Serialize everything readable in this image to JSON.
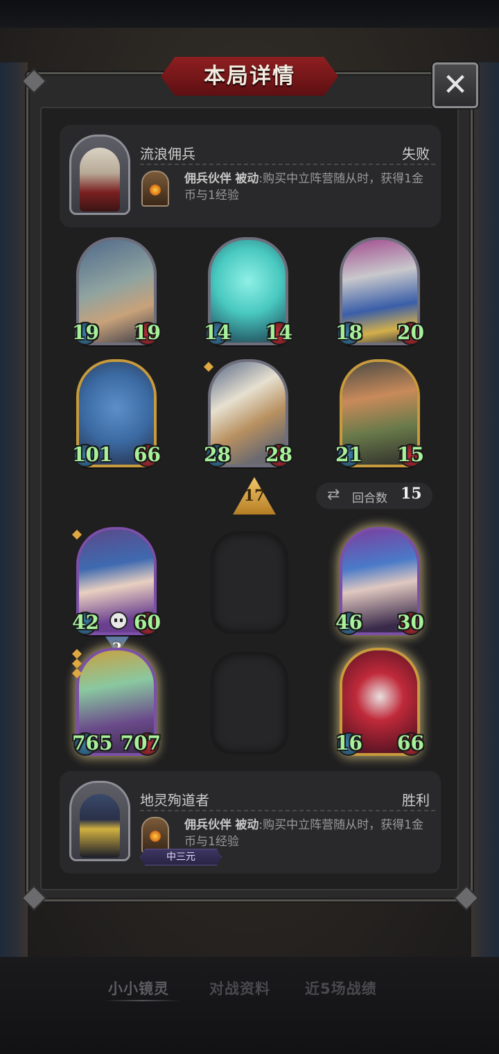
{
  "window": {
    "title": "本局详情",
    "close_icon": "close-icon"
  },
  "players": {
    "top": {
      "name": "流浪佣兵",
      "result": "失败",
      "hero_power_name": "佣兵伙伴",
      "hero_power_type": "被动",
      "hero_power_desc": ":购买中立阵营随从时，获得1金币与1经验"
    },
    "bottom": {
      "name": "地灵殉道者",
      "result": "胜利",
      "hero_power_name": "佣兵伙伴",
      "hero_power_type": "被动",
      "hero_power_desc": ":购买中立阵营随从时，获得1金币与1经验",
      "rank_badge": "中三元"
    }
  },
  "board_top": [
    {
      "attack": "19",
      "health": "19",
      "frame": "silver",
      "portrait_icon": "dragon-portrait-icon"
    },
    {
      "attack": "14",
      "health": "14",
      "frame": "silver",
      "portrait_icon": "ghost-portrait-icon"
    },
    {
      "attack": "18",
      "health": "20",
      "frame": "silver",
      "portrait_icon": "knight-portrait-icon"
    },
    {
      "attack": "101",
      "health": "66",
      "frame": "gold",
      "portrait_icon": "blue-dragon-portrait-icon"
    },
    {
      "attack": "28",
      "health": "28",
      "frame": "silver",
      "portrait_icon": "cavalry-portrait-icon"
    },
    {
      "attack": "21",
      "health": "15",
      "frame": "gold",
      "portrait_icon": "dwarf-portrait-icon"
    }
  ],
  "tavern_tier": "17",
  "rounds": {
    "label": "回合数",
    "value": "15"
  },
  "board_bottom": [
    {
      "attack": "42",
      "health": "60",
      "frame": "epic",
      "portrait_icon": "sorceress-portrait-icon"
    },
    {
      "attack": "46",
      "health": "30",
      "frame": "epic",
      "portrait_icon": "elf-portrait-icon"
    },
    {
      "attack": "765",
      "health": "707",
      "frame": "epic",
      "portrait_icon": "beast-portrait-icon"
    },
    {
      "attack": "16",
      "health": "66",
      "frame": "gold",
      "portrait_icon": "jester-portrait-icon"
    }
  ],
  "hourglass_count": "2",
  "bottom_tabs": [
    "小小镜灵",
    "对战资料",
    "近5场战绩"
  ],
  "colors": {
    "stat_green": "#a8f19a",
    "title_red": "#8e1f21",
    "gold_frame": "#c79a3c",
    "epic_frame": "#7c4fa8"
  }
}
